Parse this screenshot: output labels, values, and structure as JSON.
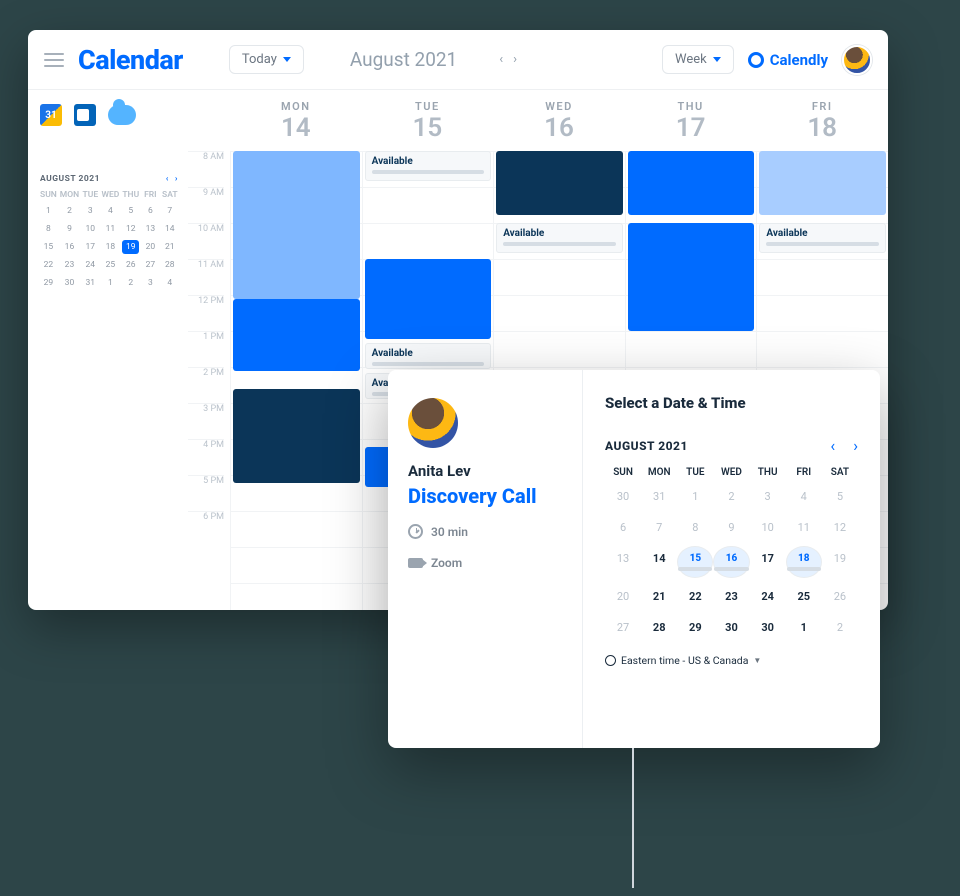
{
  "header": {
    "brand": "Calendar",
    "today_label": "Today",
    "period": "August 2021",
    "view_label": "Week",
    "provider": "Calendly"
  },
  "integrations": {
    "gcal_day": "31"
  },
  "mini_cal": {
    "title": "AUGUST 2021",
    "dow": [
      "SUN",
      "MON",
      "TUE",
      "WED",
      "THU",
      "FRI",
      "SAT"
    ],
    "weeks": [
      [
        1,
        2,
        3,
        4,
        5,
        6,
        7
      ],
      [
        8,
        9,
        10,
        11,
        12,
        13,
        14
      ],
      [
        15,
        16,
        17,
        18,
        19,
        20,
        21
      ],
      [
        22,
        23,
        24,
        25,
        26,
        27,
        28
      ],
      [
        29,
        30,
        31,
        1,
        2,
        3,
        4
      ]
    ],
    "highlighted": 19
  },
  "week": {
    "days": [
      {
        "dow": "MON",
        "num": "14"
      },
      {
        "dow": "TUE",
        "num": "15"
      },
      {
        "dow": "WED",
        "num": "16"
      },
      {
        "dow": "THU",
        "num": "17"
      },
      {
        "dow": "FRI",
        "num": "18"
      }
    ],
    "hours": [
      "8 AM",
      "9 AM",
      "10 AM",
      "11 AM",
      "12 PM",
      "1 PM",
      "2 PM",
      "3 PM",
      "4 PM",
      "5 PM",
      "6 PM"
    ],
    "available_label": "Available"
  },
  "popup": {
    "host": "Anita Lev",
    "event": "Discovery Call",
    "duration": "30 min",
    "location": "Zoom",
    "title": "Select a Date & Time",
    "month": "AUGUST 2021",
    "dow": [
      "SUN",
      "MON",
      "TUE",
      "WED",
      "THU",
      "FRI",
      "SAT"
    ],
    "grid": [
      [
        {
          "n": 30
        },
        {
          "n": 31
        },
        {
          "n": 1
        },
        {
          "n": 2
        },
        {
          "n": 3
        },
        {
          "n": 4
        },
        {
          "n": 5
        }
      ],
      [
        {
          "n": 6
        },
        {
          "n": 7
        },
        {
          "n": 8
        },
        {
          "n": 9
        },
        {
          "n": 10
        },
        {
          "n": 11
        },
        {
          "n": 12
        }
      ],
      [
        {
          "n": 13
        },
        {
          "n": 14,
          "cur": true
        },
        {
          "n": 15,
          "avail": true
        },
        {
          "n": 16,
          "avail": true
        },
        {
          "n": 17,
          "cur": true
        },
        {
          "n": 18,
          "avail": true
        },
        {
          "n": 19
        }
      ],
      [
        {
          "n": 20
        },
        {
          "n": 21,
          "cur": true
        },
        {
          "n": 22,
          "cur": true
        },
        {
          "n": 23,
          "cur": true
        },
        {
          "n": 24,
          "cur": true
        },
        {
          "n": 25,
          "cur": true
        },
        {
          "n": 26
        }
      ],
      [
        {
          "n": 27
        },
        {
          "n": 28,
          "cur": true
        },
        {
          "n": 29,
          "cur": true
        },
        {
          "n": 30,
          "cur": true
        },
        {
          "n": 30,
          "cur": true
        },
        {
          "n": 1,
          "cur": true
        },
        {
          "n": 2
        }
      ]
    ],
    "timezone": "Eastern time - US & Canada"
  }
}
